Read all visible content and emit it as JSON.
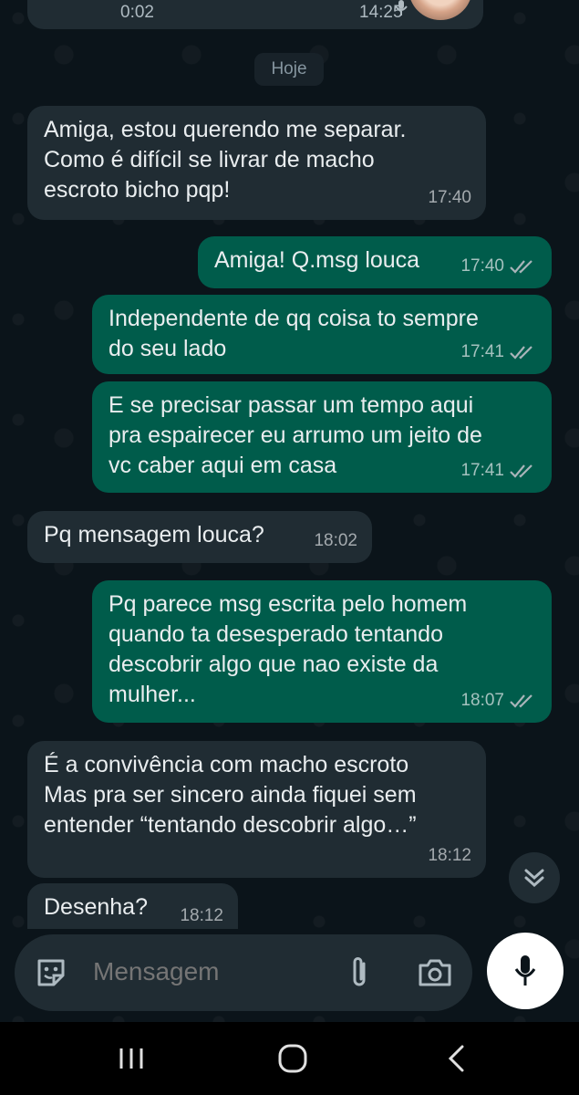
{
  "header_card": {
    "left_time": "0:02",
    "right_time": "14:25"
  },
  "date_chip": "Hoje",
  "messages": [
    {
      "dir": "in",
      "text": "Amiga, estou querendo me separar.\nComo é difícil se livrar de macho\nescroto bicho pqp!",
      "time": "17:40"
    },
    {
      "dir": "out",
      "text": "Amiga! Q.msg louca",
      "time": "17:40",
      "status": "read"
    },
    {
      "dir": "out",
      "text": "Independente de qq coisa to sempre\ndo seu lado",
      "time": "17:41",
      "status": "read"
    },
    {
      "dir": "out",
      "text": "E se precisar passar um tempo aqui\npra espairecer eu arrumo um jeito de\nvc caber aqui em casa",
      "time": "17:41",
      "status": "read"
    },
    {
      "dir": "in",
      "text": "Pq mensagem louca?",
      "time": "18:02"
    },
    {
      "dir": "out",
      "text": "Pq parece msg escrita pelo homem\nquando ta desesperado tentando\ndescobrir algo que nao existe da\nmulher...",
      "time": "18:07",
      "status": "read"
    },
    {
      "dir": "in",
      "text": "É a convivência com macho escroto\nMas pra ser sincero ainda fiquei sem\nentender “tentando descobrir algo…”",
      "time": "18:12"
    },
    {
      "dir": "in",
      "text": "Desenha?",
      "time": "18:12"
    }
  ],
  "composer": {
    "placeholder": "Mensagem"
  },
  "icons": {
    "emoji": "sticker-emoji-icon",
    "attach": "paperclip-icon",
    "camera": "camera-icon",
    "mic": "microphone-icon",
    "scroll": "double-chevron-down-icon",
    "nav_recent": "recent-apps-icon",
    "nav_home": "home-icon",
    "nav_back": "back-icon"
  },
  "colors": {
    "background": "#0b141a",
    "incoming": "#202c33",
    "outgoing": "#005c4b",
    "text": "#e9edef",
    "read_ticks": "#a9b4b9",
    "mic_button": "#ffffff"
  }
}
